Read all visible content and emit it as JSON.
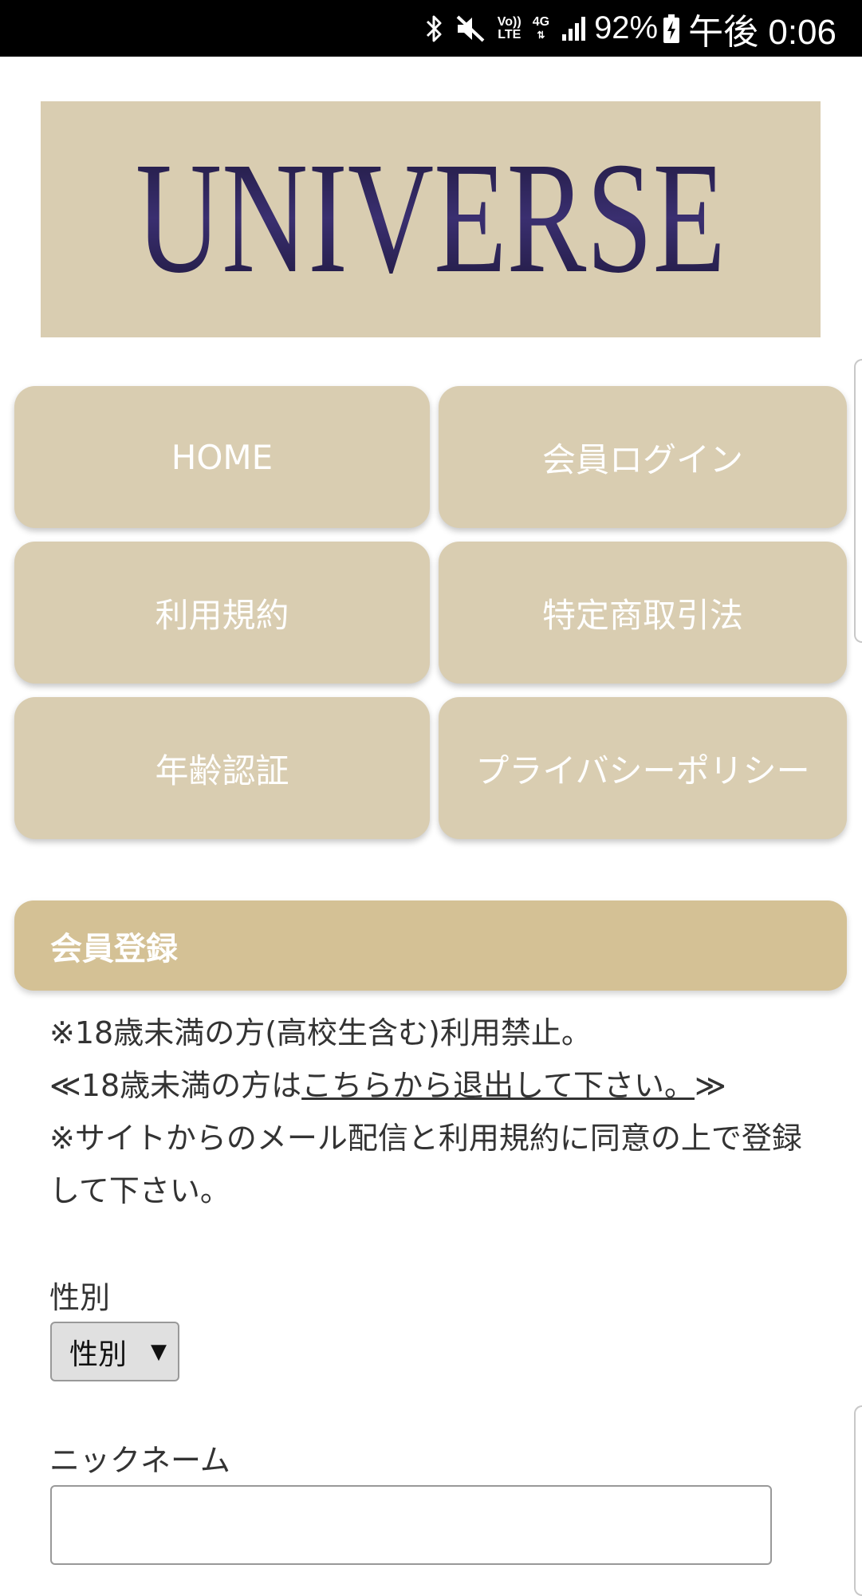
{
  "status_bar": {
    "bluetooth_icon": "bluetooth-icon",
    "mute_icon": "mute-icon",
    "volte_top": "Vo))",
    "volte_bottom": "LTE",
    "network_type": "4G",
    "signal_icon": "signal-icon",
    "battery_percent": "92%",
    "battery_icon": "battery-charging-icon",
    "time": "午後 0:06"
  },
  "logo": {
    "text": "UNIVERSE",
    "background_color": "#d9cdb1",
    "text_color": "#2a2150"
  },
  "nav": {
    "home": "HOME",
    "member_login": "会員ログイン",
    "terms_of_use": "利用規約",
    "commercial_transactions": "特定商取引法",
    "age_verification": "年齢認証",
    "privacy_policy": "プライバシーポリシー"
  },
  "section": {
    "title": "会員登録"
  },
  "notice": {
    "line1": "※18歳未満の方(高校生含む)利用禁止。",
    "line2_prefix": "≪18歳未満の方は",
    "line2_link": "こちらから退出して下さい。",
    "line2_suffix": "≫",
    "line3": "※サイトからのメール配信と利用規約に同意の上で登録して下さい。"
  },
  "form": {
    "gender_label": "性別",
    "gender_select_value": "性別",
    "gender_arrow": "▼",
    "nickname_label": "ニックネーム",
    "nickname_value": ""
  },
  "colors": {
    "nav_button": "#d9cdb1",
    "section_header": "#d4c195",
    "status_bar": "#000000"
  }
}
